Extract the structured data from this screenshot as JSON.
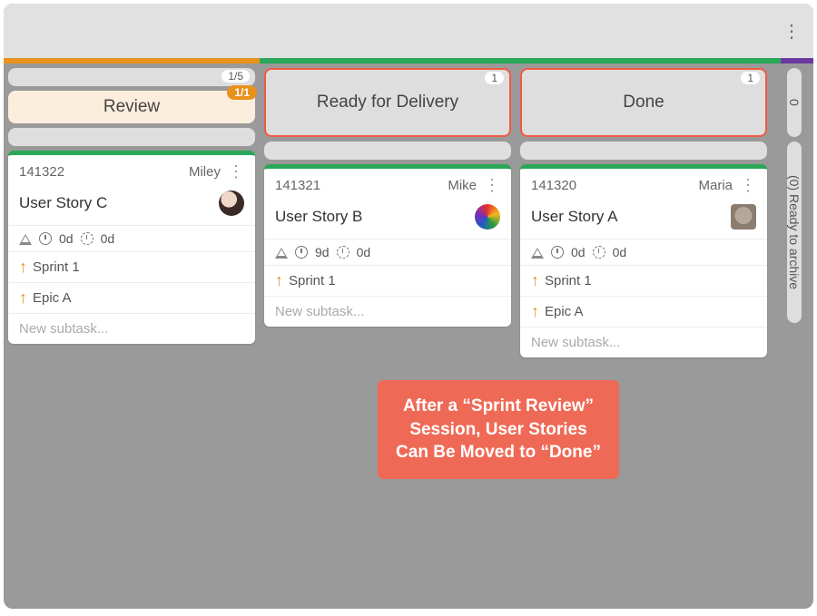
{
  "top": {
    "count_label": "1/5"
  },
  "columns": {
    "review": {
      "label": "Review",
      "badge": "1/1"
    },
    "ready": {
      "label": "Ready for Delivery",
      "count": "1"
    },
    "done": {
      "label": "Done",
      "count": "1"
    }
  },
  "cards": [
    {
      "id": "141322",
      "assignee": "Miley",
      "title": "User Story C",
      "time1": "0d",
      "time2": "0d",
      "links": [
        "Sprint 1",
        "Epic A"
      ],
      "subtask_placeholder": "New subtask..."
    },
    {
      "id": "141321",
      "assignee": "Mike",
      "title": "User Story B",
      "time1": "9d",
      "time2": "0d",
      "links": [
        "Sprint 1"
      ],
      "subtask_placeholder": "New subtask..."
    },
    {
      "id": "141320",
      "assignee": "Maria",
      "title": "User Story A",
      "time1": "0d",
      "time2": "0d",
      "links": [
        "Sprint 1",
        "Epic A"
      ],
      "subtask_placeholder": "New subtask..."
    }
  ],
  "side": {
    "count": "0",
    "archive_label": "(0) Ready to archive"
  },
  "callout": "After a “Sprint Review” Session, User Stories Can Be Moved to “Done”"
}
